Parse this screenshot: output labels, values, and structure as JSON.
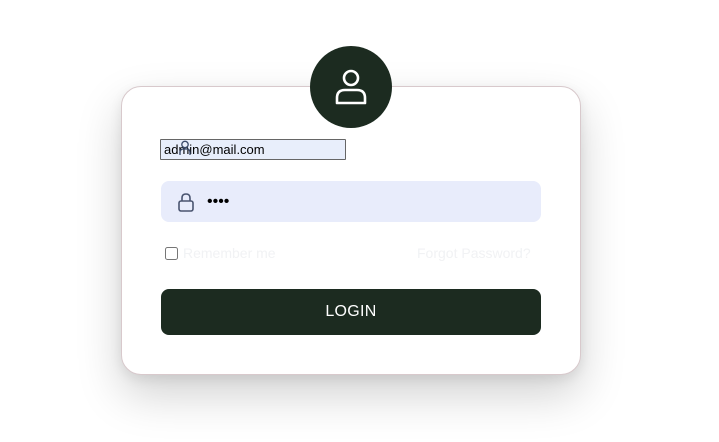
{
  "login_form": {
    "avatar_icon": "user-icon",
    "email": {
      "value": "admin@mail.com",
      "icon": "user-icon"
    },
    "password": {
      "value": "••••",
      "icon": "lock-icon"
    },
    "remember_label": "Remember me",
    "forgot_label": "Forgot Password?",
    "login_label": "LOGIN"
  },
  "colors": {
    "accent": "#1c2b20",
    "input_bg": "#e8ecfb",
    "card_bg": "#ffffff",
    "faint_text": "#f1f2f4"
  }
}
